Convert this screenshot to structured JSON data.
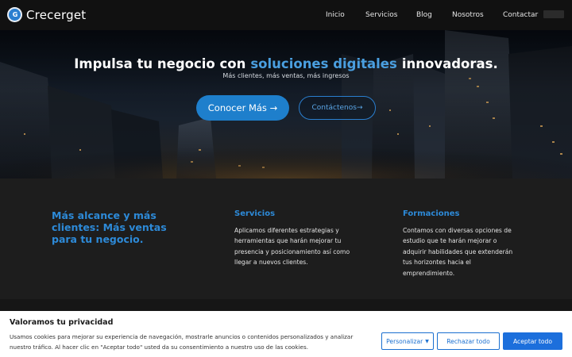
{
  "brand": {
    "logo_text": "G",
    "name": "Crecerget"
  },
  "nav": {
    "items": [
      {
        "label": "Inicio"
      },
      {
        "label": "Servicios"
      },
      {
        "label": "Blog"
      },
      {
        "label": "Nosotros"
      },
      {
        "label": "Contactar"
      }
    ]
  },
  "hero": {
    "title_before": "Impulsa tu negocio con",
    "title_highlight": "soluciones digitales",
    "title_after": "innovadoras.",
    "subtitle": "Más clientes, más ventas, más ingresos",
    "primary_button": "Conocer Más →",
    "secondary_button": "Contáctenos→"
  },
  "features": {
    "tagline": "Más alcance y más clientes: Más ventas para tu negocio.",
    "columns": [
      {
        "title": "Servicios",
        "text": "Aplicamos diferentes estrategias y herramientas que harán mejorar tu presencia y posicionamiento así como llegar a nuevos clientes."
      },
      {
        "title": "Formaciones",
        "text": "Contamos con diversas opciones de estudio que te harán mejorar o adquirir habilidades que extenderán tus horizontes hacia el emprendimiento."
      }
    ]
  },
  "cookie_banner": {
    "title": "Valoramos tu privacidad",
    "text": "Usamos cookies para mejorar su experiencia de navegación, mostrarle anuncios o contenidos personalizados y analizar nuestro tráfico. Al hacer clic en \"Aceptar todo\" usted da su consentimiento a nuestro uso de las cookies.",
    "customize_button": "Personalizar",
    "reject_button": "Rechazar todo",
    "accept_button": "Aceptar todo"
  },
  "colors": {
    "accent": "#2d8ad8",
    "primary_button": "#1e7fcc",
    "cookie_accent": "#1c6fdc",
    "nav_bg": "#111111",
    "section_bg": "#1d1d1d"
  }
}
